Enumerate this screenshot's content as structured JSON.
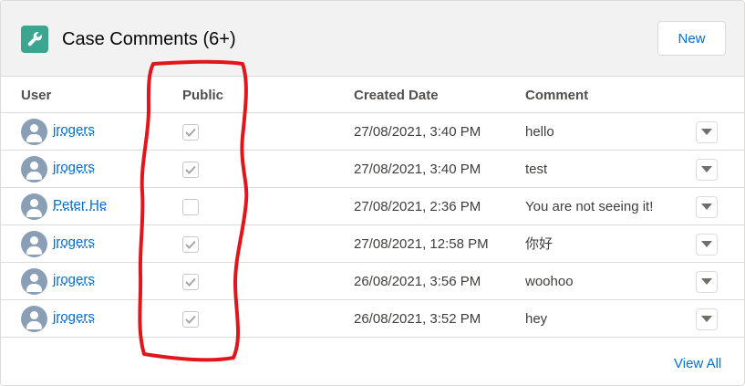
{
  "header": {
    "title": "Case Comments (6+)",
    "icon": "wrench-icon",
    "icon_color": "#3ba58f",
    "new_label": "New"
  },
  "columns": {
    "user": "User",
    "public": "Public",
    "created_date": "Created Date",
    "comment": "Comment"
  },
  "rows": [
    {
      "user": "jrogers",
      "public": true,
      "created_date": "27/08/2021, 3:40 PM",
      "comment": "hello"
    },
    {
      "user": "jrogers",
      "public": true,
      "created_date": "27/08/2021, 3:40 PM",
      "comment": "test"
    },
    {
      "user": "Peter He",
      "public": false,
      "created_date": "27/08/2021, 2:36 PM",
      "comment": "You are not seeing it!"
    },
    {
      "user": "jrogers",
      "public": true,
      "created_date": "27/08/2021, 12:58 PM",
      "comment": "你好"
    },
    {
      "user": "jrogers",
      "public": true,
      "created_date": "26/08/2021, 3:56 PM",
      "comment": "woohoo"
    },
    {
      "user": "jrogers",
      "public": true,
      "created_date": "26/08/2021, 3:52 PM",
      "comment": "hey"
    }
  ],
  "footer": {
    "view_all_label": "View All"
  },
  "colors": {
    "link": "#006dcc",
    "annotation": "#e0161c",
    "checkmark": "#b0adab"
  }
}
